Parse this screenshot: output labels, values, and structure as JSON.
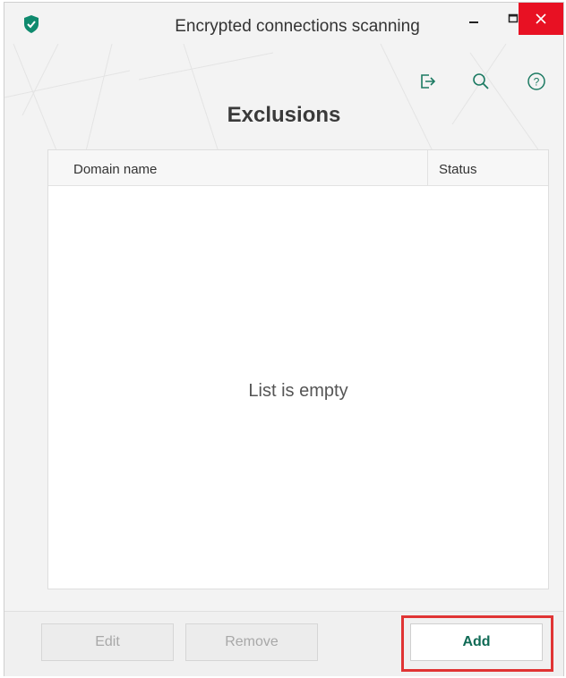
{
  "window": {
    "title": "Encrypted connections scanning",
    "app_icon": "kaspersky-shield-icon",
    "controls": {
      "minimize": "–",
      "maximize": "□",
      "close": "✕"
    }
  },
  "toolbar": {
    "icons": [
      "export-icon",
      "search-icon",
      "help-icon"
    ]
  },
  "page": {
    "heading": "Exclusions"
  },
  "table": {
    "columns": [
      "Domain name",
      "Status"
    ],
    "rows": [],
    "empty_message": "List is empty"
  },
  "buttons": {
    "edit": "Edit",
    "remove": "Remove",
    "add": "Add"
  },
  "colors": {
    "accent": "#0f6a55",
    "close": "#e81123",
    "highlight": "#e03434"
  }
}
